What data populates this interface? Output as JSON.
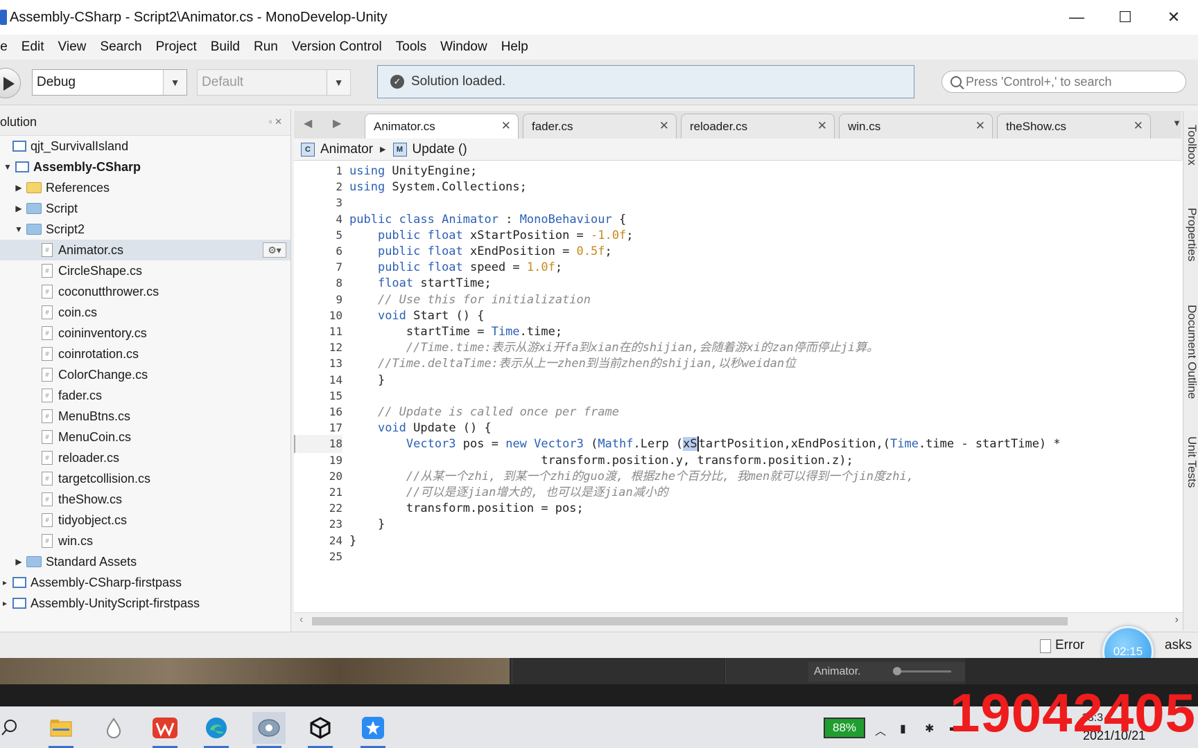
{
  "window": {
    "title": "Assembly-CSharp - Script2\\Animator.cs - MonoDevelop-Unity",
    "minimize": "—",
    "maximize": "☐",
    "close": "✕"
  },
  "menu": [
    "le",
    "Edit",
    "View",
    "Search",
    "Project",
    "Build",
    "Run",
    "Version Control",
    "Tools",
    "Window",
    "Help"
  ],
  "toolbar": {
    "config": "Debug",
    "platform": "Default",
    "status": "Solution loaded.",
    "search_placeholder": "Press 'Control+,' to search"
  },
  "solution": {
    "title": "olution",
    "items": [
      {
        "label": "qjt_SurvivalIsland",
        "kind": "solution"
      },
      {
        "label": "Assembly-CSharp",
        "kind": "project-bold"
      },
      {
        "label": "References",
        "kind": "folder-yellow"
      },
      {
        "label": "Script",
        "kind": "folder"
      },
      {
        "label": "Script2",
        "kind": "folder-open"
      },
      {
        "label": "Animator.cs",
        "kind": "file",
        "selected": true
      },
      {
        "label": "CircleShape.cs",
        "kind": "file"
      },
      {
        "label": "coconutthrower.cs",
        "kind": "file"
      },
      {
        "label": "coin.cs",
        "kind": "file"
      },
      {
        "label": "coininventory.cs",
        "kind": "file"
      },
      {
        "label": "coinrotation.cs",
        "kind": "file"
      },
      {
        "label": "ColorChange.cs",
        "kind": "file"
      },
      {
        "label": "fader.cs",
        "kind": "file"
      },
      {
        "label": "MenuBtns.cs",
        "kind": "file"
      },
      {
        "label": "MenuCoin.cs",
        "kind": "file"
      },
      {
        "label": "reloader.cs",
        "kind": "file"
      },
      {
        "label": "targetcollision.cs",
        "kind": "file"
      },
      {
        "label": "theShow.cs",
        "kind": "file"
      },
      {
        "label": "tidyobject.cs",
        "kind": "file"
      },
      {
        "label": "win.cs",
        "kind": "file"
      },
      {
        "label": "Standard Assets",
        "kind": "folder"
      },
      {
        "label": "Assembly-CSharp-firstpass",
        "kind": "project"
      },
      {
        "label": "Assembly-UnityScript-firstpass",
        "kind": "project"
      }
    ]
  },
  "tabs": [
    "Animator.cs",
    "fader.cs",
    "reloader.cs",
    "win.cs",
    "theShow.cs"
  ],
  "breadcrumb": {
    "class": "Animator",
    "method": "Update ()"
  },
  "code": {
    "line_numbers": [
      "1",
      "2",
      "3",
      "4",
      "5",
      "6",
      "7",
      "8",
      "9",
      "10",
      "11",
      "12",
      "13",
      "14",
      "15",
      "16",
      "17",
      "18",
      "19",
      "20",
      "21",
      "22",
      "23",
      "24",
      "25"
    ],
    "current_line": "18"
  },
  "right_dock": [
    "Toolbox",
    "Properties",
    "Document Outline",
    "Unit Tests"
  ],
  "bottom_pads": {
    "errors": "Error",
    "tasks": "asks",
    "timer": "02:15"
  },
  "unity": {
    "animator_label": "Animator."
  },
  "taskbar": {
    "battery": "88%",
    "date": "2021/10/21",
    "time": "13:3"
  },
  "watermark": "19042405",
  "colors": {
    "keyword": "#2b5fb5",
    "number": "#c58a1e",
    "comment": "#8a8a8a",
    "watermark": "#ee1c1c"
  }
}
